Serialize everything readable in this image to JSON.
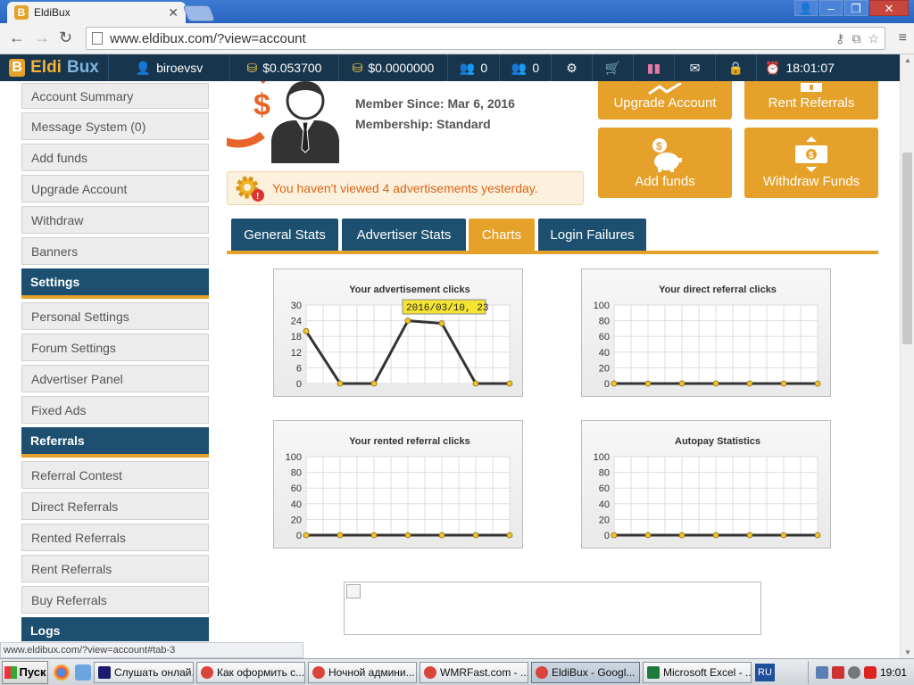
{
  "browser": {
    "tab_title": "EldiBux",
    "tab_favicon_letter": "B",
    "url": "www.eldibux.com/?view=account",
    "status_url": "www.eldibux.com/?view=account#tab-3"
  },
  "topnav": {
    "logo_prefix": "Eldi",
    "logo_suffix": "Bux",
    "username": "biroevsv",
    "balance_main": "$0.053700",
    "balance_purchase": "$0.0000000",
    "direct_refs": "0",
    "rented_refs": "0",
    "time": "18:01:07"
  },
  "sidebar": {
    "group1": [
      "Account Summary",
      "Message System (0)",
      "Add funds",
      "Upgrade Account",
      "Withdraw",
      "Banners"
    ],
    "settings_head": "Settings",
    "group2": [
      "Personal Settings",
      "Forum Settings",
      "Advertiser Panel",
      "Fixed Ads"
    ],
    "referrals_head": "Referrals",
    "group3": [
      "Referral Contest",
      "Direct Referrals",
      "Rented Referrals",
      "Rent Referrals",
      "Buy Referrals"
    ],
    "logs_head": "Logs"
  },
  "profile": {
    "member_since": "Member Since: Mar 6, 2016",
    "membership": "Membership: Standard"
  },
  "actions": {
    "upgrade": "Upgrade Account",
    "rent": "Rent Referrals",
    "addfunds": "Add funds",
    "withdraw": "Withdraw Funds"
  },
  "notice": "You haven't viewed 4 advertisements yesterday.",
  "tabs": [
    "General Stats",
    "Advertiser Stats",
    "Charts",
    "Login Failures"
  ],
  "colors": {
    "accent": "#e6a12b",
    "nav_dark": "#17364e",
    "tab_blue": "#1d5070",
    "notice_text": "#d9651b"
  },
  "chart_data": [
    {
      "type": "line",
      "title": "Your advertisement clicks",
      "y_ticks": [
        0,
        6,
        12,
        18,
        24,
        30
      ],
      "ylim": [
        0,
        30
      ],
      "values": [
        20,
        0,
        0,
        24,
        23,
        0,
        0
      ],
      "tooltip": "2016/03/10, 23"
    },
    {
      "type": "line",
      "title": "Your direct referral clicks",
      "y_ticks": [
        0,
        20,
        40,
        60,
        80,
        100
      ],
      "ylim": [
        0,
        100
      ],
      "values": [
        0,
        0,
        0,
        0,
        0,
        0,
        0
      ]
    },
    {
      "type": "line",
      "title": "Your rented referral clicks",
      "y_ticks": [
        0,
        20,
        40,
        60,
        80,
        100
      ],
      "ylim": [
        0,
        100
      ],
      "values": [
        0,
        0,
        0,
        0,
        0,
        0,
        0
      ]
    },
    {
      "type": "line",
      "title": "Autopay Statistics",
      "y_ticks": [
        0,
        20,
        40,
        60,
        80,
        100
      ],
      "ylim": [
        0,
        100
      ],
      "values": [
        0,
        0,
        0,
        0,
        0,
        0,
        0
      ]
    }
  ],
  "taskbar": {
    "start": "Пуск",
    "tasks": [
      "Слушать онлай...",
      "Как оформить с...",
      "Ночной админи...",
      "WMRFast.com - ...",
      "EldiBux - Googl...",
      "Microsoft Excel - ..."
    ],
    "lang": "RU",
    "clock": "19:01"
  }
}
